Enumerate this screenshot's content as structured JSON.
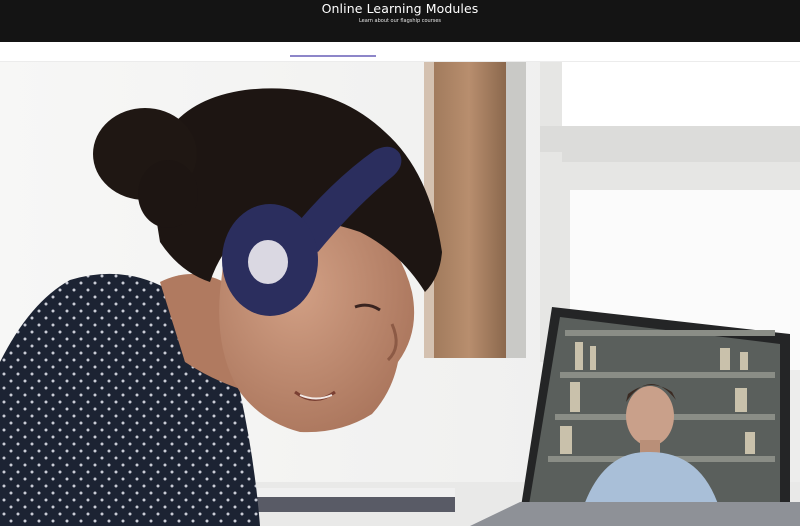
{
  "header": {
    "title": "Online Learning Modules",
    "subtitle": "Learn about our flagship courses"
  },
  "hero": {
    "image_icon": "woman-headphones-video-call-photo"
  },
  "colors": {
    "header_bg": "#141414",
    "accent": "#8d86c9",
    "headphones": "#2b2e5e"
  }
}
